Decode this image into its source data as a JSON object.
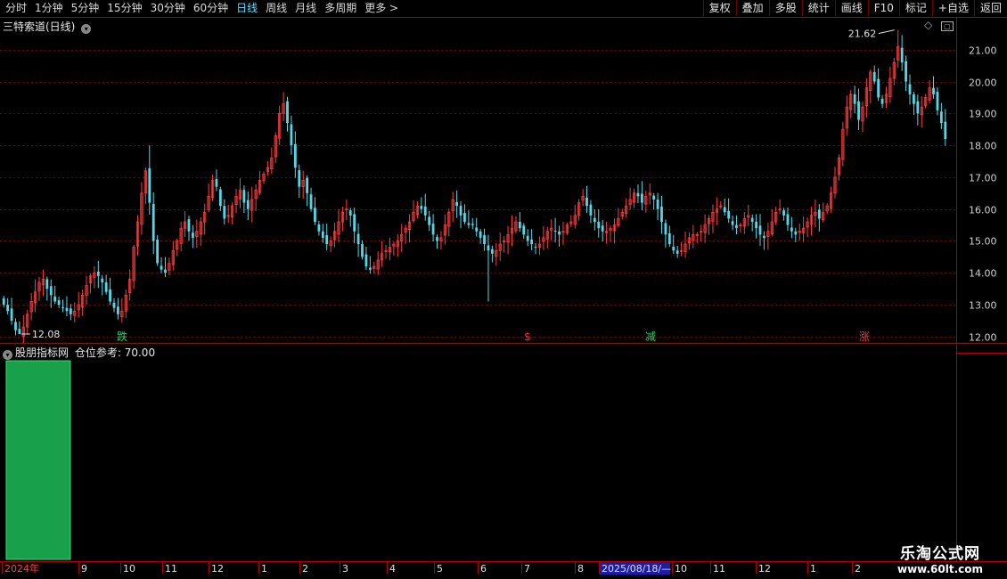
{
  "toolbar": {
    "periods": [
      "分时",
      "1分钟",
      "5分钟",
      "15分钟",
      "30分钟",
      "60分钟",
      "日线",
      "周线",
      "月线",
      "多周期",
      "更多 >"
    ],
    "active_period": "日线",
    "tools": [
      "复权",
      "叠加",
      "多股",
      "统计",
      "画线",
      "F10",
      "标记",
      "+自选",
      "返回"
    ]
  },
  "main_panel": {
    "title": "三特索道(日线)",
    "high_label": "21.62",
    "low_label": "12.08",
    "signals": [
      {
        "text": "跌",
        "color": "#2bd06a"
      },
      {
        "text": "$",
        "color": "#ff3030"
      },
      {
        "text": "减",
        "color": "#2bd06a"
      },
      {
        "text": "涨",
        "color": "#ff3030"
      }
    ]
  },
  "sub_panel": {
    "title": "股朋指标网",
    "indicator_label": "仓位参考:",
    "indicator_value": "70.00",
    "bar_color": "#18a04a"
  },
  "date_axis": {
    "labels": [
      "2024年",
      "9",
      "10",
      "11",
      "12",
      "1",
      "2",
      "3",
      "4",
      "5",
      "6",
      "7",
      "8",
      "2025/08/18/—",
      "10",
      "11",
      "12",
      "1",
      "2"
    ],
    "highlight": "2025/08/18/—"
  },
  "watermark": {
    "line1": "乐淘公式网",
    "line2": "www.60lt.com"
  },
  "colors": {
    "up": "#ff3c3c",
    "down": "#54d8e8",
    "grid": "#7a0000",
    "axis": "#b00000"
  },
  "chart_data": {
    "type": "candlestick",
    "ylim": [
      11.8,
      22.0
    ],
    "yticks": [
      12.0,
      13.0,
      14.0,
      15.0,
      16.0,
      17.0,
      18.0,
      19.0,
      20.0,
      21.0
    ],
    "closes": [
      13.0,
      12.8,
      12.5,
      12.2,
      12.08,
      12.3,
      12.7,
      13.1,
      13.4,
      13.7,
      13.8,
      13.5,
      13.3,
      13.1,
      13.0,
      12.9,
      12.8,
      12.7,
      12.8,
      13.0,
      13.3,
      13.6,
      13.9,
      14.0,
      13.9,
      13.7,
      13.4,
      13.1,
      12.9,
      12.7,
      12.8,
      13.3,
      13.8,
      14.8,
      15.6,
      16.5,
      17.2,
      16.2,
      15.0,
      14.3,
      14.1,
      14.0,
      14.3,
      14.7,
      15.0,
      15.4,
      15.6,
      15.3,
      15.1,
      15.3,
      15.6,
      15.9,
      16.4,
      16.9,
      16.7,
      16.1,
      15.7,
      15.8,
      16.1,
      16.4,
      16.6,
      16.2,
      16.0,
      16.3,
      16.6,
      16.9,
      17.1,
      17.3,
      17.6,
      18.3,
      19.0,
      19.3,
      18.7,
      18.0,
      17.3,
      16.7,
      16.9,
      16.5,
      16.0,
      15.6,
      15.3,
      15.1,
      14.9,
      15.0,
      15.3,
      15.6,
      15.9,
      16.0,
      15.8,
      15.3,
      14.9,
      14.5,
      14.2,
      14.1,
      14.2,
      14.4,
      14.6,
      14.7,
      14.8,
      14.9,
      15.0,
      15.2,
      15.4,
      15.6,
      15.9,
      16.1,
      16.0,
      15.8,
      15.5,
      15.2,
      15.0,
      15.1,
      15.5,
      15.9,
      16.3,
      16.1,
      15.8,
      15.6,
      15.5,
      15.5,
      15.3,
      15.1,
      14.9,
      14.7,
      14.6,
      14.7,
      14.9,
      15.0,
      15.2,
      15.4,
      15.6,
      15.4,
      15.2,
      15.0,
      14.9,
      14.8,
      14.9,
      15.1,
      15.3,
      15.4,
      15.3,
      15.2,
      15.3,
      15.5,
      15.6,
      15.8,
      16.2,
      16.4,
      16.1,
      15.8,
      15.6,
      15.4,
      15.3,
      15.3,
      15.4,
      15.5,
      15.7,
      15.9,
      16.1,
      16.3,
      16.5,
      16.4,
      16.2,
      16.4,
      16.5,
      16.3,
      16.0,
      15.6,
      15.2,
      14.9,
      14.7,
      14.6,
      14.7,
      14.9,
      15.1,
      15.2,
      15.2,
      15.3,
      15.5,
      15.7,
      15.9,
      16.0,
      16.1,
      15.9,
      15.7,
      15.5,
      15.4,
      15.5,
      15.7,
      15.8,
      15.6,
      15.4,
      15.2,
      15.1,
      15.3,
      15.6,
      15.9,
      16.0,
      15.8,
      15.5,
      15.3,
      15.2,
      15.3,
      15.4,
      15.6,
      15.8,
      15.9,
      15.7,
      15.9,
      16.1,
      16.5,
      17.0,
      17.6,
      18.5,
      19.2,
      19.6,
      19.3,
      18.8,
      19.2,
      19.8,
      20.3,
      20.0,
      19.5,
      19.3,
      19.6,
      20.1,
      20.6,
      21.1,
      20.6,
      20.0,
      19.6,
      19.3,
      19.0,
      19.2,
      19.5,
      19.8,
      19.6,
      19.1,
      18.7,
      18.2
    ]
  }
}
